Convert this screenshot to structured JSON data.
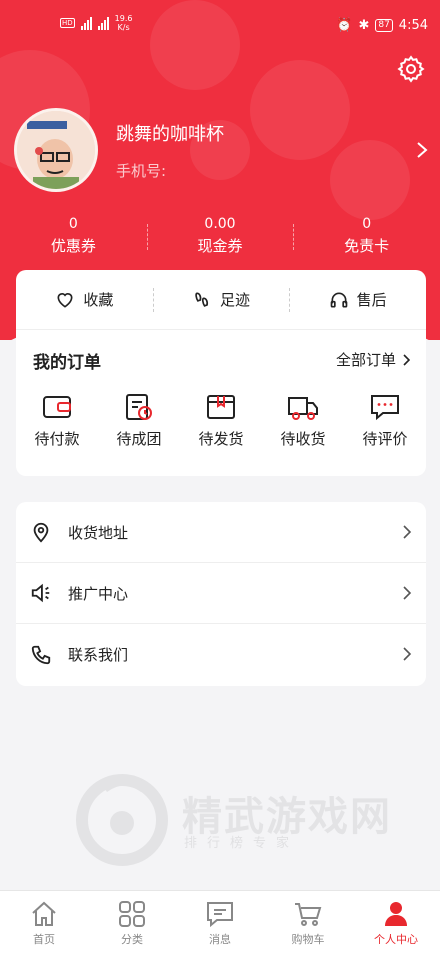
{
  "status_bar": {
    "network_speed": "19.6",
    "network_speed_unit": "K/s",
    "battery": "87",
    "time": "4:54"
  },
  "profile": {
    "username": "跳舞的咖啡杯",
    "phone_label": "手机号:"
  },
  "stats": [
    {
      "value": "0",
      "label": "优惠券"
    },
    {
      "value": "0.00",
      "label": "现金券"
    },
    {
      "value": "0",
      "label": "免责卡"
    }
  ],
  "quick_links": [
    {
      "label": "收藏",
      "icon": "heart-icon"
    },
    {
      "label": "足迹",
      "icon": "footprint-icon"
    },
    {
      "label": "售后",
      "icon": "headphones-icon"
    }
  ],
  "orders": {
    "title": "我的订单",
    "all_label": "全部订单",
    "items": [
      {
        "label": "待付款",
        "icon": "wallet-icon"
      },
      {
        "label": "待成团",
        "icon": "group-clock-icon"
      },
      {
        "label": "待发货",
        "icon": "package-icon"
      },
      {
        "label": "待收货",
        "icon": "truck-icon"
      },
      {
        "label": "待评价",
        "icon": "comment-icon"
      }
    ]
  },
  "menu": [
    {
      "label": "收货地址",
      "icon": "location-pin-icon"
    },
    {
      "label": "推广中心",
      "icon": "speaker-icon"
    },
    {
      "label": "联系我们",
      "icon": "phone-icon"
    }
  ],
  "watermark": {
    "title": "精武游戏网",
    "subtitle": "排行榜专家"
  },
  "tabbar": [
    {
      "label": "首页",
      "icon": "home-icon",
      "active": false
    },
    {
      "label": "分类",
      "icon": "grid-icon",
      "active": false
    },
    {
      "label": "消息",
      "icon": "message-icon",
      "active": false
    },
    {
      "label": "购物车",
      "icon": "cart-icon",
      "active": false
    },
    {
      "label": "个人中心",
      "icon": "person-icon",
      "active": true
    }
  ],
  "colors": {
    "brand_red": "#ef2f3f",
    "active_tab": "#e8282e",
    "background": "#f4f4f6"
  }
}
